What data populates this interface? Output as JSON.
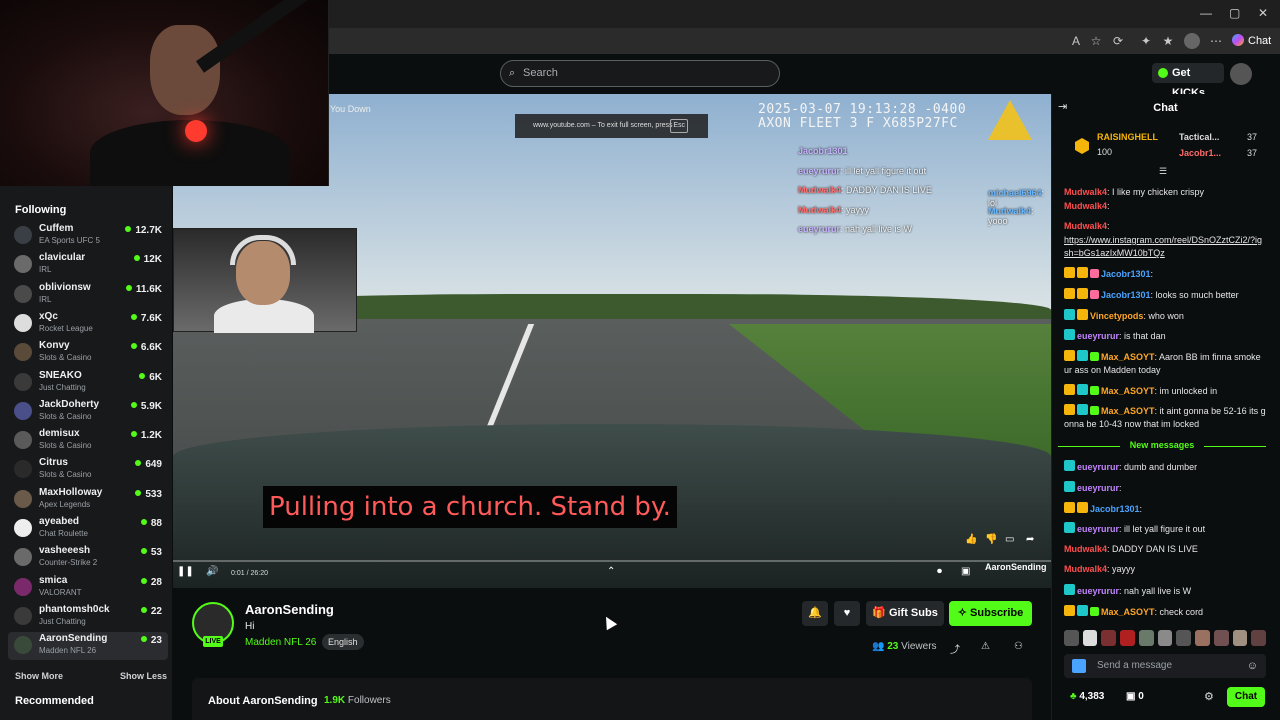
{
  "browser": {
    "window_controls": [
      "—",
      "▢",
      "✕"
    ],
    "chat_button": "Chat"
  },
  "header": {
    "search_placeholder": "Search",
    "get_kicks": "Get KICKs"
  },
  "sidebar": {
    "following_title": "Following",
    "items": [
      {
        "name": "Cuffem",
        "category": "EA Sports UFC 5",
        "viewers": "12.7K"
      },
      {
        "name": "clavicular",
        "category": "IRL",
        "viewers": "12K"
      },
      {
        "name": "oblivionsw",
        "category": "IRL",
        "viewers": "11.6K"
      },
      {
        "name": "xQc",
        "category": "Rocket League",
        "viewers": "7.6K"
      },
      {
        "name": "Konvy",
        "category": "Slots & Casino",
        "viewers": "6.6K"
      },
      {
        "name": "SNEAKO",
        "category": "Just Chatting",
        "viewers": "6K"
      },
      {
        "name": "JackDoherty",
        "category": "Slots & Casino",
        "viewers": "5.9K"
      },
      {
        "name": "demisux",
        "category": "Slots & Casino",
        "viewers": "1.2K"
      },
      {
        "name": "Citrus",
        "category": "Slots & Casino",
        "viewers": "649"
      },
      {
        "name": "MaxHolloway",
        "category": "Apex Legends",
        "viewers": "533"
      },
      {
        "name": "ayeabed",
        "category": "Chat Roulette",
        "viewers": "88"
      },
      {
        "name": "vasheeesh",
        "category": "Counter-Strike 2",
        "viewers": "53"
      },
      {
        "name": "smica",
        "category": "VALORANT",
        "viewers": "28"
      },
      {
        "name": "phantomsh0ck",
        "category": "Just Chatting",
        "viewers": "22"
      },
      {
        "name": "AaronSending",
        "category": "Madden NFL 26",
        "viewers": "23"
      }
    ],
    "show_more": "Show More",
    "show_less": "Show Less",
    "recommended_title": "Recommended"
  },
  "video": {
    "yt_title": "You Down",
    "fullscreen_notice": "www.youtube.com – To exit full screen, press",
    "esc": "Esc",
    "stamp_line1": "2025-03-07 19:13:28 -0400",
    "stamp_line2": "AXON FLEET 3 F X685P27FC",
    "overlay_chat": [
      {
        "user": "Jacobr1301",
        "text": ""
      },
      {
        "user": "eueyrurur",
        "text": ": ill let yall figure it out"
      },
      {
        "user": "Mudwalk4",
        "text": ": DADDY DAN IS LIVE"
      },
      {
        "user": "Mudwalk4",
        "text": ": yayyy"
      },
      {
        "user": "eueyrurur",
        "text": ": nah yall live is W"
      }
    ],
    "overlay_chat_right": [
      {
        "user": "michael6964",
        "text": ": lol"
      },
      {
        "user": "Mudwalk4",
        "text": ": yooo"
      }
    ],
    "subtitle": "Pulling into a church. Stand by.",
    "time": "0:01 / 26:20",
    "watermark": "AaronSending"
  },
  "stream": {
    "streamer": "AaronSending",
    "live": "LIVE",
    "title": "Hi",
    "category": "Madden NFL 26",
    "language": "English",
    "gift_subs": "Gift Subs",
    "subscribe": "Subscribe",
    "viewers_count": "23",
    "viewers_label": "Viewers",
    "about_title": "About AaronSending",
    "followers_count": "1.9K",
    "followers_label": "Followers"
  },
  "chat": {
    "title": "Chat",
    "pinned": {
      "user": "RAISINGHELL",
      "points": "100",
      "leader1": "Tactical...",
      "leader1_count": "37",
      "leader2": "Jacobr1...",
      "leader2_count": "37"
    },
    "messages": [
      {
        "user": "Mudwalk4",
        "text": "I like my chicken crispy",
        "color": "c-red"
      },
      {
        "user": "Mudwalk4",
        "text": "",
        "color": "c-red"
      },
      {
        "user": "Mudwalk4",
        "text": "",
        "color": "c-red"
      },
      {
        "user": "",
        "text": "https://www.instagram.com/reel/DSnOZztCZi2/?igsh=bGs1azIxMW10bTQz",
        "color": "c-link"
      },
      {
        "user": "Jacobr1301",
        "text": "",
        "color": "c-blue"
      },
      {
        "user": "Jacobr1301",
        "text": "looks so much better",
        "color": "c-blue"
      },
      {
        "user": "Vincetypods",
        "text": "who won",
        "color": "c-orange"
      },
      {
        "user": "eueyrurur",
        "text": "is that dan",
        "color": "c-purple"
      },
      {
        "user": "Max_ASOYT",
        "text": "Aaron BB im finna smoke ur ass on Madden today",
        "color": "c-orange"
      },
      {
        "user": "Max_ASOYT",
        "text": "im unlocked in",
        "color": "c-orange"
      },
      {
        "user": "Max_ASOYT",
        "text": "it aint gonna be 52-16 its gonna be 10-43 now that im locked",
        "color": "c-orange"
      },
      {
        "user": "eueyrurur",
        "text": "dumb and dumber",
        "color": "c-purple"
      },
      {
        "user": "eueyrurur",
        "text": "",
        "color": "c-purple"
      },
      {
        "user": "Jacobr1301",
        "text": "",
        "color": "c-blue"
      },
      {
        "user": "eueyrurur",
        "text": "ill let yall figure it out",
        "color": "c-purple"
      },
      {
        "user": "Mudwalk4",
        "text": "DADDY DAN IS LIVE",
        "color": "c-red"
      },
      {
        "user": "Mudwalk4",
        "text": "yayyy",
        "color": "c-red"
      },
      {
        "user": "eueyrurur",
        "text": "nah yall live is W",
        "color": "c-purple"
      },
      {
        "user": "Max_ASOYT",
        "text": "check cord",
        "color": "c-orange"
      }
    ],
    "new_messages": "New messages",
    "input_placeholder": "Send a message",
    "points": "4,383",
    "kicks": "0",
    "chat_button": "Chat"
  },
  "colors": {
    "accent": "#53fc18",
    "background": "#0b0e0f",
    "sidebar": "#18191b"
  }
}
